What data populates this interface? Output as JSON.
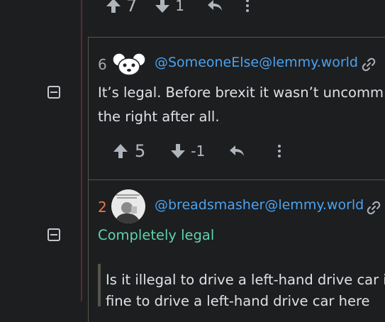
{
  "top_comment": {
    "upvotes": "7",
    "downvotes": "1"
  },
  "comment1": {
    "index": "6",
    "username": "@SomeoneElse@lemmy.world",
    "body_line1": "It’s legal. Before brexit it wasn’t uncomm",
    "body_line2": "the right after all.",
    "upvotes": "5",
    "downvotes": "-1"
  },
  "comment2": {
    "index": "2",
    "username": "@breadsmasher@lemmy.world",
    "body": "Completely legal",
    "quote_line1": "Is it illegal to drive a left-hand drive car i",
    "quote_line2": "fine to drive a left-hand drive car here"
  },
  "colors": {
    "background": "#1d1e20",
    "username": "#4ba3f0",
    "index_gray": "#a5a9ad",
    "index_orange": "#e8794a",
    "completely_legal": "#5fd3a8",
    "border": "#55554b"
  },
  "icons": [
    "arrow-up-icon",
    "arrow-down-icon",
    "reply-icon",
    "more-vertical-icon",
    "collapse-icon",
    "link-icon",
    "avatar"
  ]
}
